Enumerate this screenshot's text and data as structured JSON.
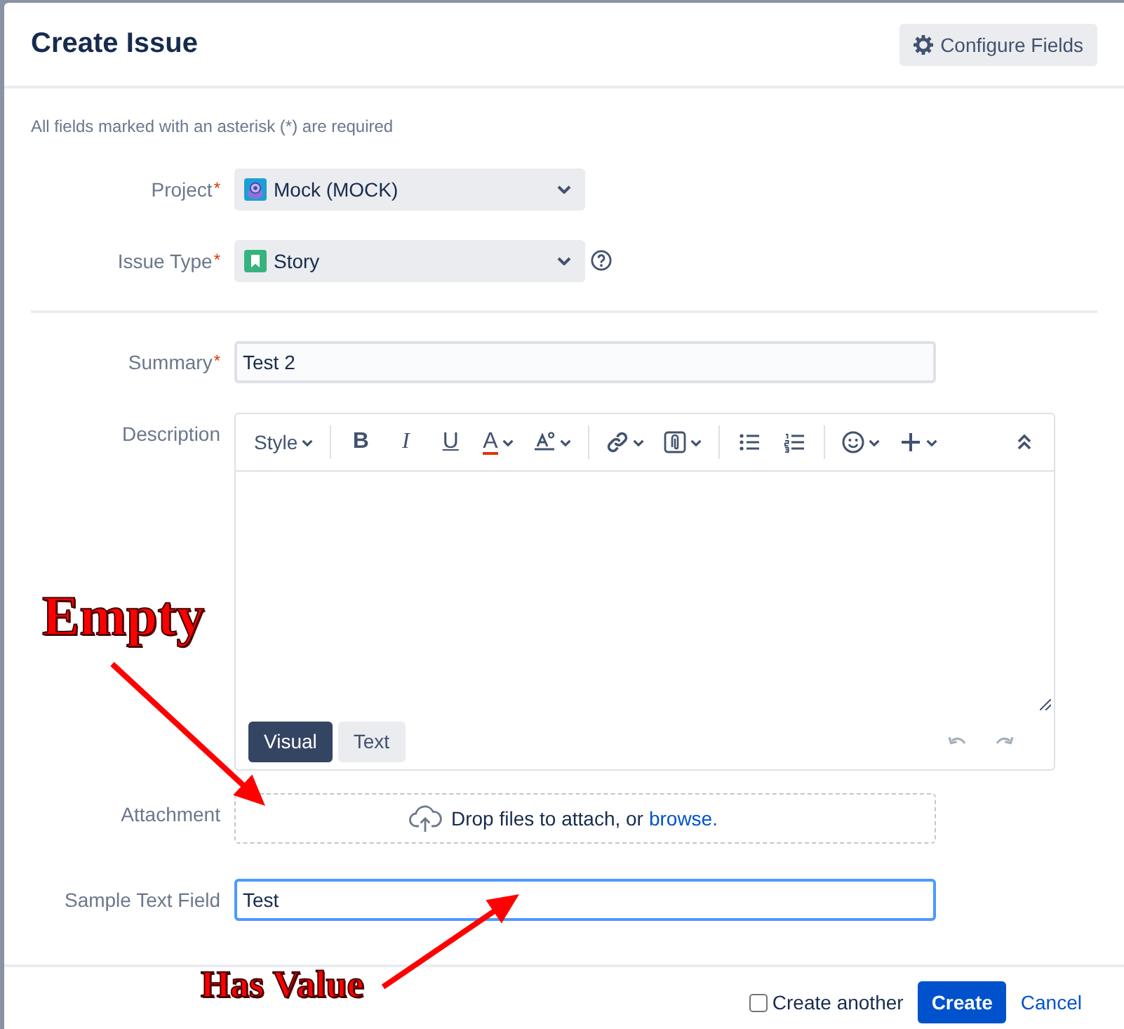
{
  "dialog": {
    "title": "Create Issue",
    "configure_button": "Configure Fields"
  },
  "required_note": "All fields marked with an asterisk (*) are required",
  "project": {
    "label": "Project",
    "required_mark": "*",
    "value": "Mock (MOCK)"
  },
  "issue_type": {
    "label": "Issue Type",
    "required_mark": "*",
    "value": "Story"
  },
  "summary": {
    "label": "Summary",
    "required_mark": "*",
    "value": "Test 2"
  },
  "description": {
    "label": "Description",
    "toolbar": {
      "style_menu": "Style",
      "bold": "B",
      "italic": "I",
      "underline": "U",
      "text_color": "A"
    },
    "modes": [
      {
        "label": "Visual",
        "selected": true
      },
      {
        "label": "Text",
        "selected": false
      }
    ]
  },
  "attachment": {
    "label": "Attachment",
    "prompt": "Drop files to attach, or",
    "link": "browse."
  },
  "sample_text_field": {
    "label": "Sample Text Field",
    "value": "Test",
    "focused": true
  },
  "footer": {
    "create_another": {
      "label": "Create another",
      "checked": false
    },
    "create_button": "Create",
    "cancel_link": "Cancel"
  },
  "annotations": [
    {
      "text": "Empty"
    },
    {
      "text": "Has Value"
    }
  ]
}
